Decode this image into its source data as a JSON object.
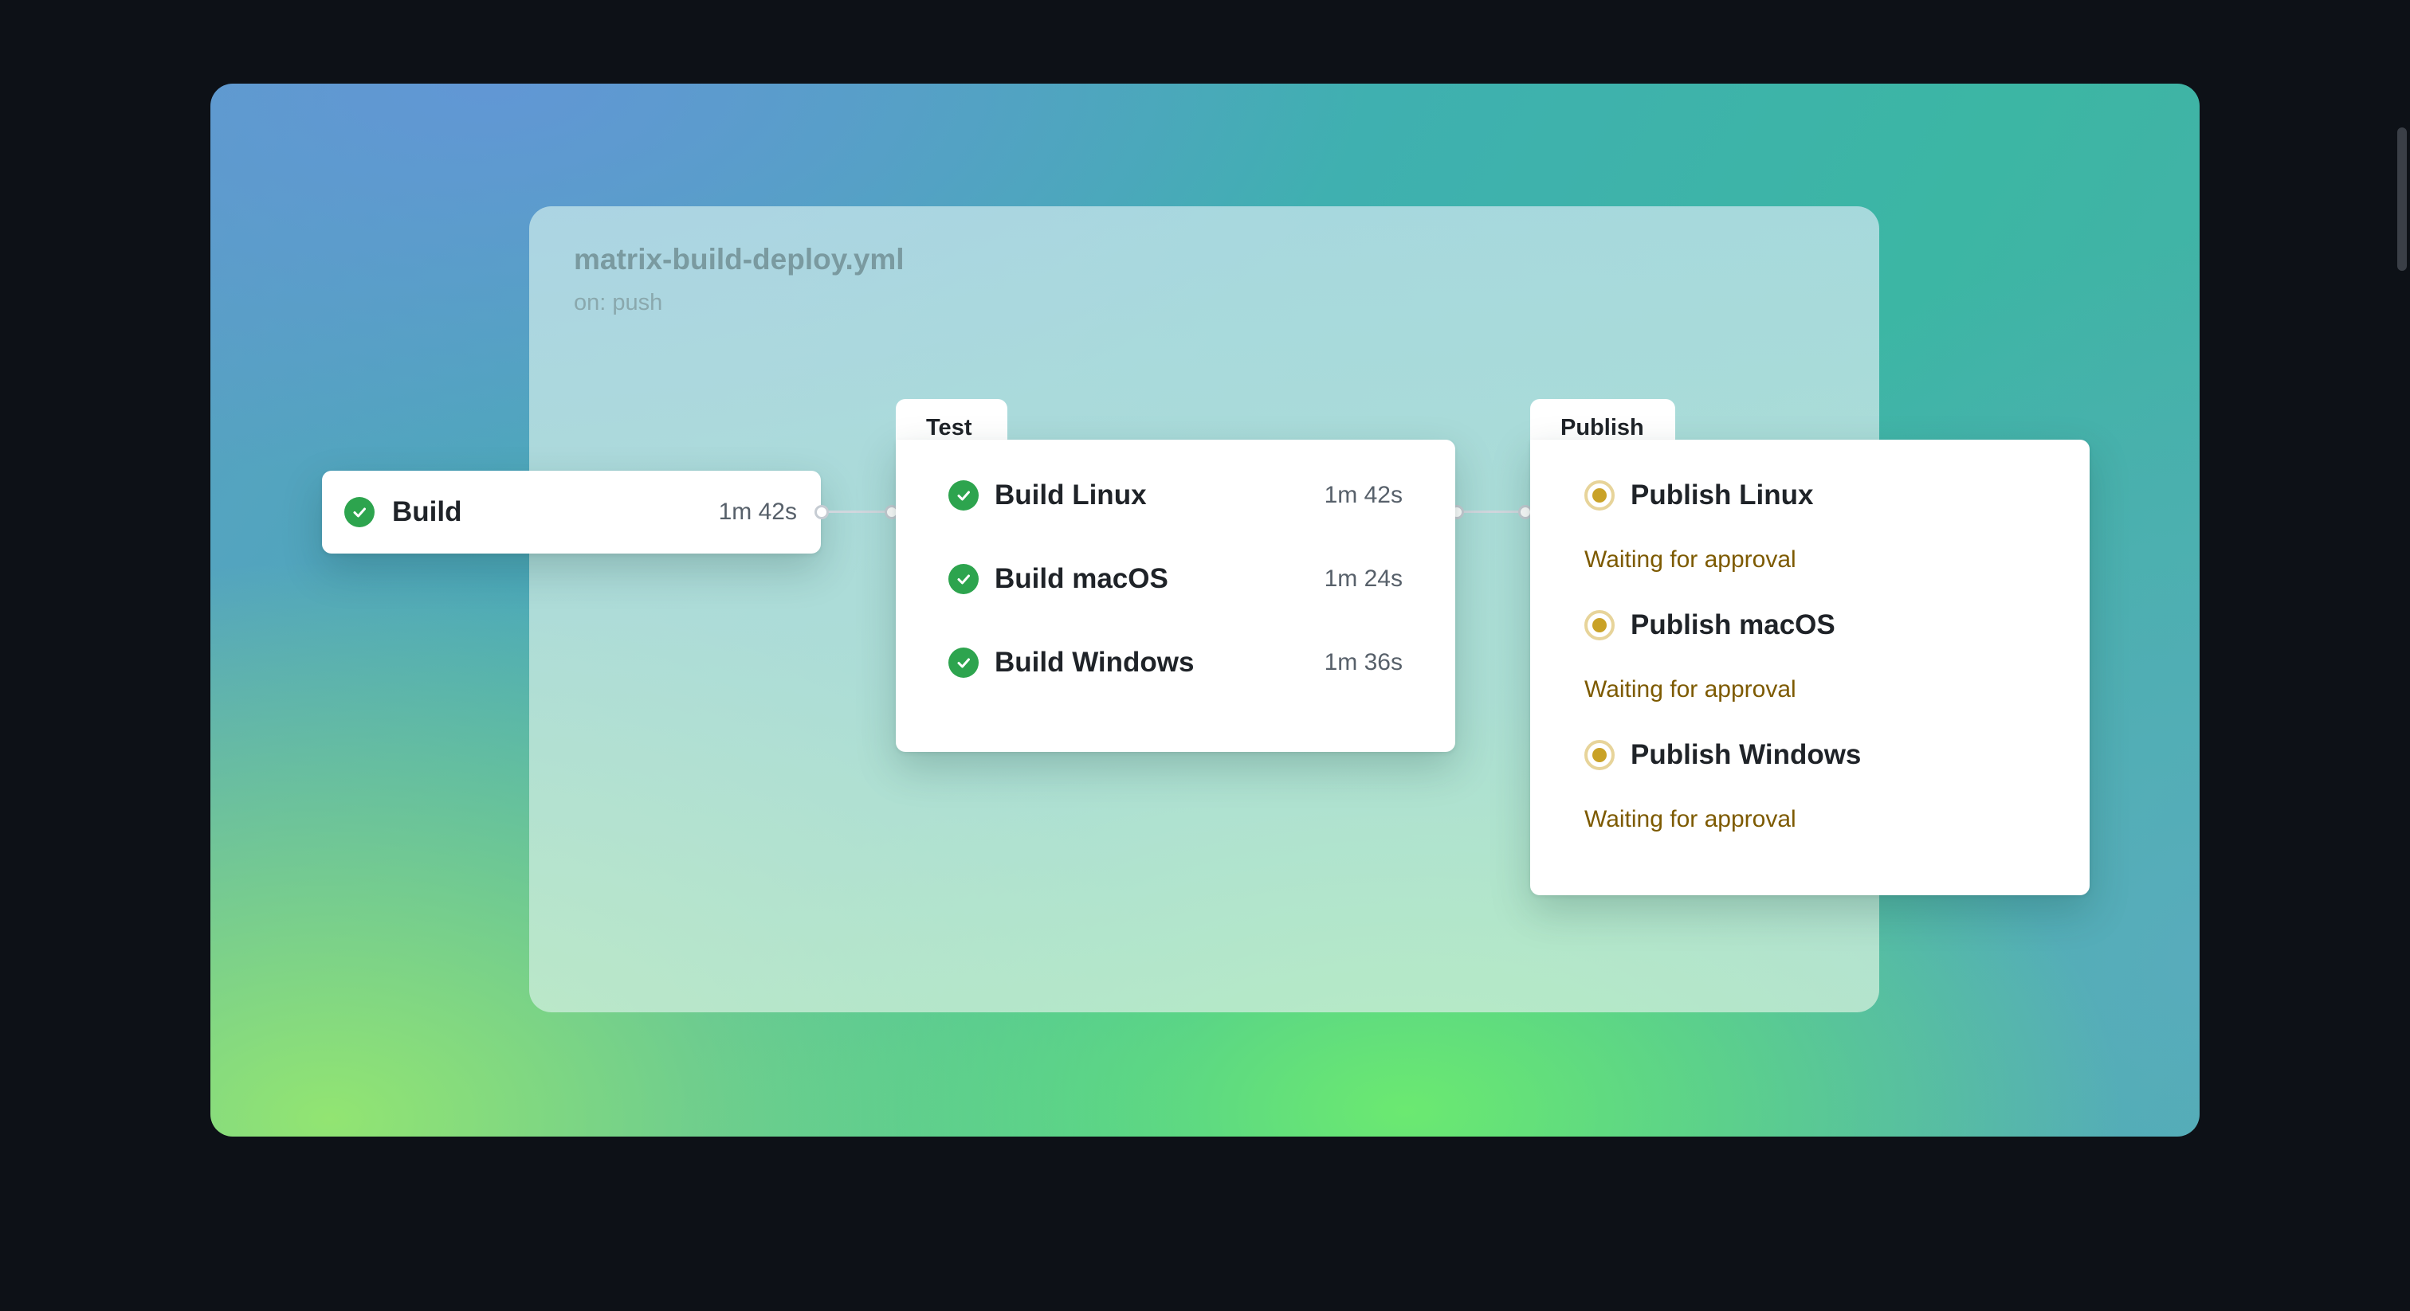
{
  "workflow": {
    "file_name": "matrix-build-deploy.yml",
    "trigger": "on: push"
  },
  "build_job": {
    "name": "Build",
    "duration": "1m 42s",
    "status": "success"
  },
  "test_group": {
    "label": "Test",
    "jobs": [
      {
        "name": "Build Linux",
        "duration": "1m 42s",
        "status": "success"
      },
      {
        "name": "Build macOS",
        "duration": "1m 24s",
        "status": "success"
      },
      {
        "name": "Build Windows",
        "duration": "1m 36s",
        "status": "success"
      }
    ]
  },
  "publish_group": {
    "label": "Publish",
    "jobs": [
      {
        "name": "Publish Linux",
        "status_text": "Waiting for approval",
        "status": "waiting"
      },
      {
        "name": "Publish macOS",
        "status_text": "Waiting for approval",
        "status": "waiting"
      },
      {
        "name": "Publish Windows",
        "status_text": "Waiting for approval",
        "status": "waiting"
      }
    ]
  },
  "icons": {
    "success": "check-circle-icon",
    "waiting": "pending-circle-icon"
  },
  "colors": {
    "success": "#2da44e",
    "waiting": "#c9a227",
    "waiting_text": "#7d5a00",
    "page_background": "#0d1117"
  }
}
